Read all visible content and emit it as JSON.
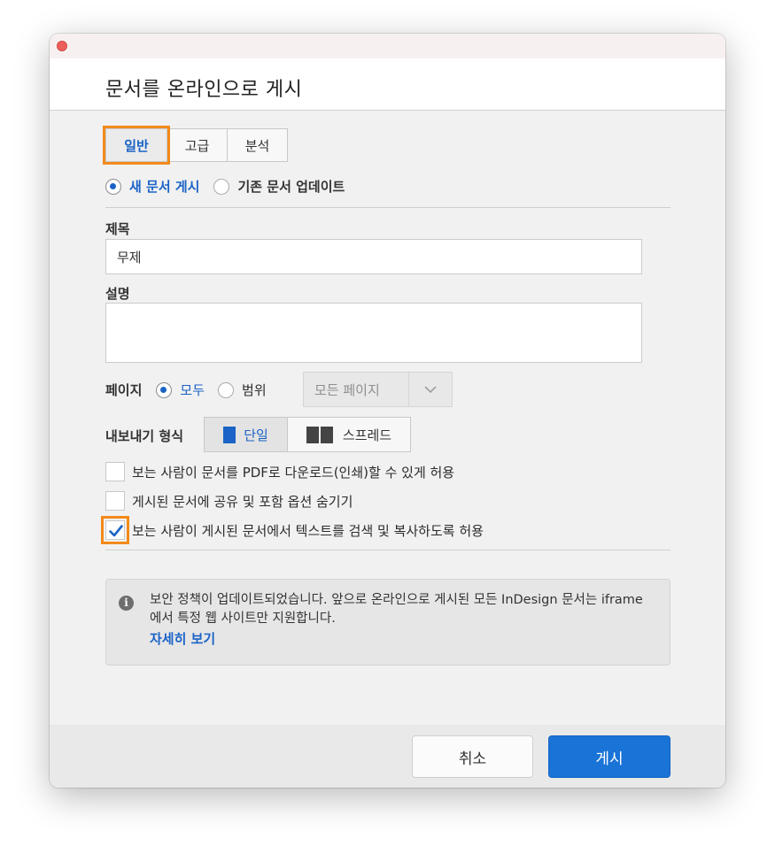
{
  "dialog": {
    "title": "문서를 온라인으로 게시"
  },
  "tabs": [
    {
      "label": "일반",
      "selected": true
    },
    {
      "label": "고급",
      "selected": false
    },
    {
      "label": "분석",
      "selected": false
    }
  ],
  "mode": {
    "new_label": "새 문서 게시",
    "update_label": "기존 문서 업데이트",
    "selected": "new"
  },
  "title_field": {
    "label": "제목",
    "value": "무제"
  },
  "description_field": {
    "label": "설명",
    "value": ""
  },
  "pages": {
    "label": "페이지",
    "all_label": "모두",
    "range_label": "범위",
    "selected": "all",
    "range_select_value": "모든 페이지"
  },
  "export_format": {
    "label": "내보내기 형식",
    "single_label": "단일",
    "spread_label": "스프레드",
    "selected": "single"
  },
  "options": [
    {
      "label": "보는 사람이 문서를 PDF로 다운로드(인쇄)할 수 있게 허용",
      "checked": false
    },
    {
      "label": "게시된 문서에 공유 및 포함 옵션 숨기기",
      "checked": false
    },
    {
      "label": "보는 사람이 게시된 문서에서 텍스트를 검색 및 복사하도록 허용",
      "checked": true
    }
  ],
  "notice": {
    "text": "보안 정책이 업데이트되었습니다. 앞으로 온라인으로 게시된 모든 InDesign 문서는 iframe에서 특정 웹 사이트만 지원합니다.",
    "link": "자세히 보기"
  },
  "buttons": {
    "cancel": "취소",
    "publish": "게시"
  },
  "colors": {
    "accent": "#1a73d6",
    "highlight": "#f28a1b"
  }
}
